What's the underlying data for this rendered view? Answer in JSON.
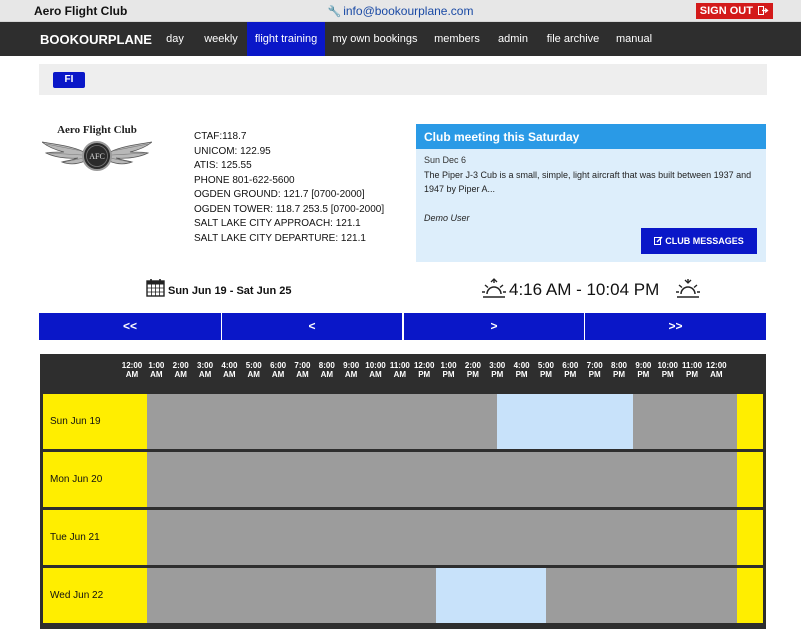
{
  "topbar": {
    "club_name": "Aero Flight Club",
    "email": "info@bookourplane.com",
    "signout_label": "SIGN OUT"
  },
  "navbar": {
    "brand": "BOOKOURPLANE",
    "items": [
      {
        "label": "day"
      },
      {
        "label": "weekly"
      },
      {
        "label": "flight training",
        "active": true
      },
      {
        "label": "my own bookings"
      },
      {
        "label": "members"
      },
      {
        "label": "admin"
      },
      {
        "label": "file archive"
      },
      {
        "label": "manual"
      }
    ]
  },
  "filter": {
    "badge": "FI"
  },
  "logo": {
    "text": "Aero Flight Club",
    "emblem": "AFC"
  },
  "frequencies": [
    "CTAF:118.7",
    "UNICOM: 122.95",
    "ATIS: 125.55",
    "PHONE 801-622-5600",
    "OGDEN GROUND: 121.7 [0700-2000]",
    "OGDEN TOWER: 118.7 253.5 [0700-2000]",
    "SALT LAKE CITY APPROACH: 121.1",
    "SALT LAKE CITY DEPARTURE: 121.1"
  ],
  "message": {
    "title": "Club meeting this Saturday",
    "date": "Sun Dec 6",
    "body": "The Piper J-3 Cub is a small, simple, light aircraft that was built between 1937 and 1947 by Piper A...",
    "author": "Demo User",
    "button_label": "CLUB MESSAGES"
  },
  "week": {
    "range": "Sun Jun 19 - Sat Jun 25",
    "sun_times": "4:16 AM - 10:04 PM"
  },
  "pager": [
    "<<",
    "<",
    ">",
    ">>"
  ],
  "colors": {
    "nav_bg": "#2e2e2e",
    "accent_blue": "#0a17c8",
    "message_header": "#2a9ae6",
    "message_bg": "#ddeefb",
    "day_label_bg": "#ffee00",
    "unavailable": "#9c9c9c",
    "available": "#c8e2fa",
    "signout_red": "#d31a1a"
  },
  "calendar": {
    "hours": [
      {
        "h": "12:00",
        "ap": "AM"
      },
      {
        "h": "1:00",
        "ap": "AM"
      },
      {
        "h": "2:00",
        "ap": "AM"
      },
      {
        "h": "3:00",
        "ap": "AM"
      },
      {
        "h": "4:00",
        "ap": "AM"
      },
      {
        "h": "5:00",
        "ap": "AM"
      },
      {
        "h": "6:00",
        "ap": "AM"
      },
      {
        "h": "7:00",
        "ap": "AM"
      },
      {
        "h": "8:00",
        "ap": "AM"
      },
      {
        "h": "9:00",
        "ap": "AM"
      },
      {
        "h": "10:00",
        "ap": "AM"
      },
      {
        "h": "11:00",
        "ap": "AM"
      },
      {
        "h": "12:00",
        "ap": "PM"
      },
      {
        "h": "1:00",
        "ap": "PM"
      },
      {
        "h": "2:00",
        "ap": "PM"
      },
      {
        "h": "3:00",
        "ap": "PM"
      },
      {
        "h": "4:00",
        "ap": "PM"
      },
      {
        "h": "5:00",
        "ap": "PM"
      },
      {
        "h": "6:00",
        "ap": "PM"
      },
      {
        "h": "7:00",
        "ap": "PM"
      },
      {
        "h": "8:00",
        "ap": "PM"
      },
      {
        "h": "9:00",
        "ap": "PM"
      },
      {
        "h": "10:00",
        "ap": "PM"
      },
      {
        "h": "11:00",
        "ap": "PM"
      },
      {
        "h": "12:00",
        "ap": "AM"
      }
    ],
    "days": [
      {
        "label": "Sun Jun 19",
        "available": [
          {
            "from": 14.25,
            "to": 19.75
          }
        ]
      },
      {
        "label": "Mon Jun 20",
        "available": []
      },
      {
        "label": "Tue Jun 21",
        "available": []
      },
      {
        "label": "Wed Jun 22",
        "available": [
          {
            "from": 11.75,
            "to": 16.25
          }
        ]
      }
    ]
  }
}
